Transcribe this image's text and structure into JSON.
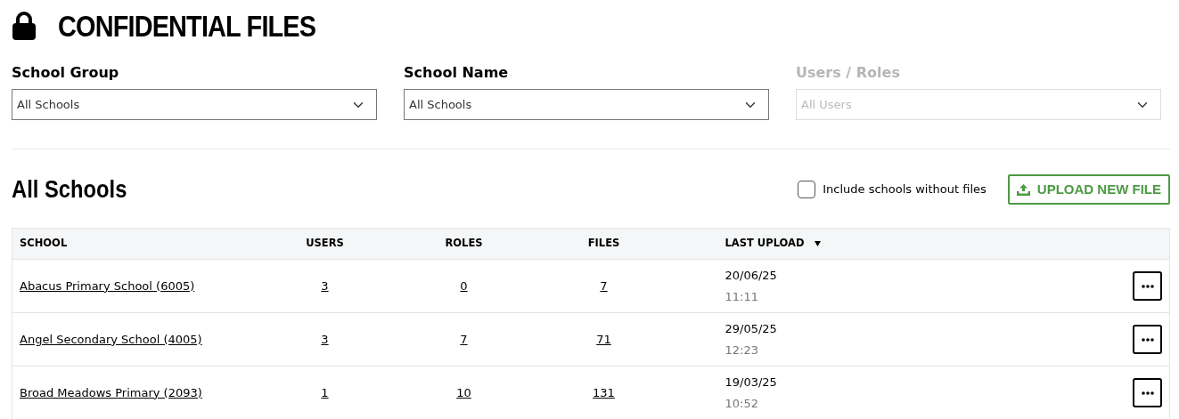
{
  "page": {
    "title": "CONFIDENTIAL FILES"
  },
  "filters": [
    {
      "label": "School Group",
      "value": "All Schools",
      "disabled": false
    },
    {
      "label": "School Name",
      "value": "All Schools",
      "disabled": false
    },
    {
      "label": "Users / Roles",
      "value": "All Users",
      "disabled": true
    }
  ],
  "section": {
    "title": "All Schools",
    "include_without_files": {
      "label": "Include schools without files",
      "checked": false
    },
    "upload_button": "UPLOAD NEW FILE"
  },
  "table": {
    "columns": [
      {
        "label": "SCHOOL",
        "sorted": false
      },
      {
        "label": "USERS",
        "sorted": false
      },
      {
        "label": "ROLES",
        "sorted": false
      },
      {
        "label": "FILES",
        "sorted": false
      },
      {
        "label": "LAST UPLOAD",
        "sorted": true
      }
    ],
    "rows": [
      {
        "school": "Abacus Primary School (6005)",
        "users": "3",
        "roles": "0",
        "files": "7",
        "date": "20/06/25",
        "time": "11:11"
      },
      {
        "school": "Angel Secondary School (4005)",
        "users": "3",
        "roles": "7",
        "files": "71",
        "date": "29/05/25",
        "time": "12:23"
      },
      {
        "school": "Broad Meadows Primary (2093)",
        "users": "1",
        "roles": "10",
        "files": "131",
        "date": "19/03/25",
        "time": "10:52"
      }
    ]
  }
}
